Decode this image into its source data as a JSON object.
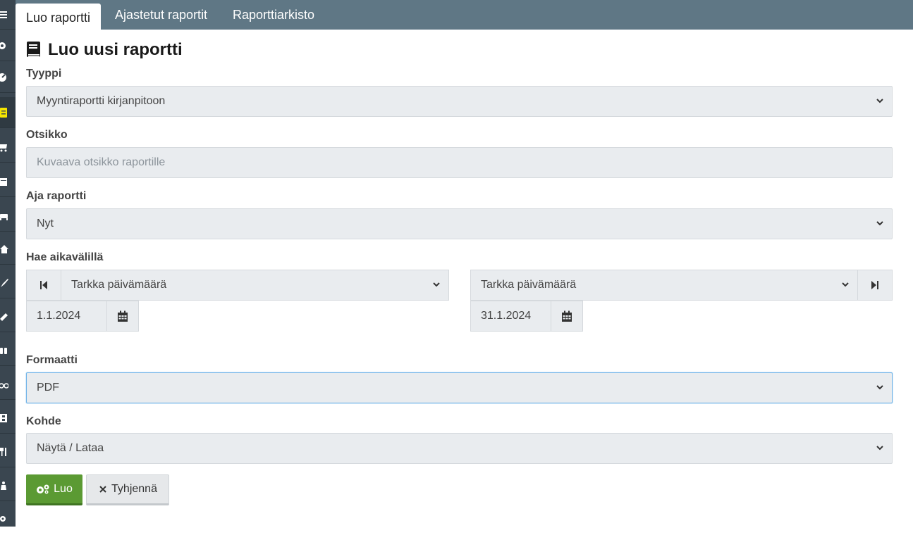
{
  "tabs": [
    {
      "label": "Luo raportti",
      "active": true
    },
    {
      "label": "Ajastetut raportit",
      "active": false
    },
    {
      "label": "Raporttiarkisto",
      "active": false
    }
  ],
  "sidebar": {
    "icons": [
      "menu-icon",
      "settings-icon",
      "dashboard-icon",
      "reports-icon",
      "cart-icon",
      "calendar-icon",
      "bed-icon",
      "home-icon",
      "brush-icon",
      "ruler-icon",
      "binoculars-icon",
      "bicycle-icon",
      "film-icon",
      "restaurant-icon",
      "person-icon",
      "gears-icon"
    ],
    "active_icon": "reports-icon"
  },
  "page_title": "Luo uusi raportti",
  "form": {
    "type": {
      "label": "Tyyppi",
      "value": "Myyntiraportti kirjanpitoon"
    },
    "title": {
      "label": "Otsikko",
      "placeholder": "Kuvaava otsikko raportille",
      "value": ""
    },
    "run": {
      "label": "Aja raportti",
      "value": "Nyt"
    },
    "range": {
      "label": "Hae aikavälillä",
      "start_mode": "Tarkka päivämäärä",
      "end_mode": "Tarkka päivämäärä",
      "start_date": "1.1.2024",
      "end_date": "31.1.2024"
    },
    "format": {
      "label": "Formaatti",
      "value": "PDF"
    },
    "target": {
      "label": "Kohde",
      "value": "Näytä / Lataa"
    }
  },
  "buttons": {
    "create": "Luo",
    "clear": "Tyhjennä"
  },
  "colors": {
    "tabbar": "#5f7785",
    "sidebar": "#3a4650",
    "primary_button": "#5b9a33",
    "active_sidebar_icon": "#f5e600",
    "focus_border": "#6fb3e8"
  }
}
